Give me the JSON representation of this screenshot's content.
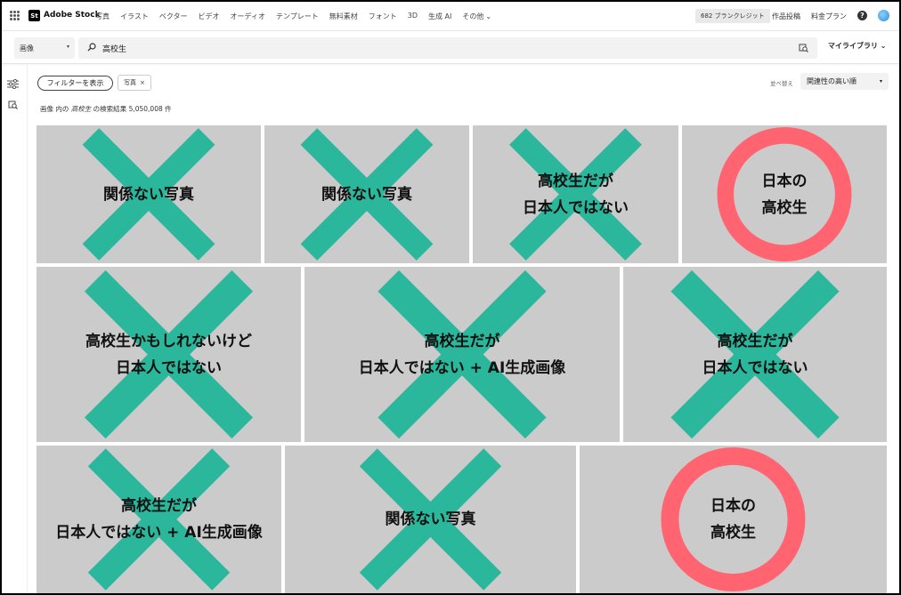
{
  "nav": {
    "logo_mark": "St",
    "brand": "Adobe Stock",
    "items": [
      "写真",
      "イラスト",
      "ベクター",
      "ビデオ",
      "オーディオ",
      "テンプレート",
      "無料素材",
      "フォント",
      "3D",
      "生成 AI",
      "その他"
    ],
    "credits": "682 ブランクレジット",
    "portfolio": "作品投稿",
    "pricing": "料金プラン",
    "help_glyph": "?"
  },
  "search": {
    "scope": "画像",
    "query": "高校生",
    "library": "マイライブラリ"
  },
  "filters": {
    "show_filters": "フィルターを表示",
    "active_tag": "写真",
    "tag_close": "×",
    "sort_label": "並べ替え",
    "sort_value": "関連性の高い順"
  },
  "results": {
    "prefix": "画像 内の",
    "term": "高校生",
    "middle": "の検索結果",
    "count": "5,050,008",
    "suffix": "件"
  },
  "colors": {
    "cross": "#2bb79b",
    "circle": "#ff6470",
    "tile": "#cbcbcb"
  },
  "tiles": [
    {
      "mark": "cross",
      "lines": [
        "関係ない写真"
      ]
    },
    {
      "mark": "cross",
      "lines": [
        "関係ない写真"
      ]
    },
    {
      "mark": "cross",
      "lines": [
        "高校生だが",
        "日本人ではない"
      ]
    },
    {
      "mark": "circle",
      "lines": [
        "日本の",
        "高校生"
      ]
    },
    {
      "mark": "cross",
      "lines": [
        "高校生かもしれないけど",
        "日本人ではない"
      ]
    },
    {
      "mark": "cross",
      "lines": [
        "高校生だが",
        "日本人ではない + AI生成画像"
      ]
    },
    {
      "mark": "cross",
      "lines": [
        "高校生だが",
        "日本人ではない"
      ]
    },
    {
      "mark": "cross",
      "lines": [
        "高校生だが",
        "日本人ではない + AI生成画像"
      ]
    },
    {
      "mark": "cross",
      "lines": [
        "関係ない写真"
      ]
    },
    {
      "mark": "circle",
      "lines": [
        "日本の",
        "高校生"
      ]
    }
  ]
}
